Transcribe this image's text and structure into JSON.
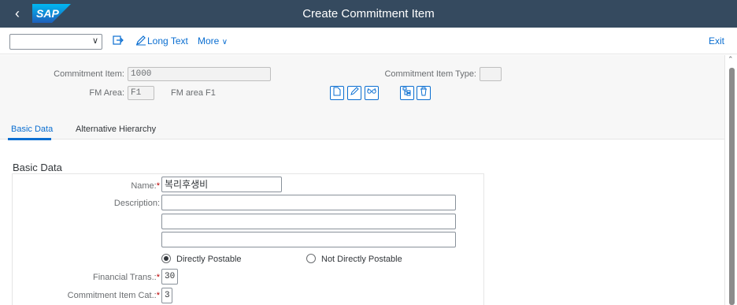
{
  "app": {
    "title": "Create Commitment Item",
    "logo_text": "SAP",
    "back_glyph": "‹"
  },
  "toolbar": {
    "dropdown_value": "",
    "long_text_label": "Long Text",
    "more_label": "More",
    "exit_label": "Exit"
  },
  "header": {
    "commitment_item_label": "Commitment Item:",
    "commitment_item_value": "1000",
    "fm_area_label": "FM Area:",
    "fm_area_value": "F1",
    "fm_area_desc": "FM area F1",
    "commitment_item_type_label": "Commitment Item Type:",
    "commitment_item_type_value": ""
  },
  "tabs": [
    {
      "label": "Basic Data",
      "active": true
    },
    {
      "label": "Alternative Hierarchy",
      "active": false
    }
  ],
  "basic_data": {
    "section_title": "Basic Data",
    "name_label": "Name:",
    "name_value": "복리후생비",
    "description_label": "Description:",
    "description_lines": [
      "",
      "",
      ""
    ],
    "radio_directly_postable": "Directly Postable",
    "radio_not_directly_postable": "Not Directly Postable",
    "selected_radio": "Directly Postable",
    "financial_trans_label": "Financial Trans.:",
    "financial_trans_value": "30",
    "commitment_item_cat_label": "Commitment Item Cat.:",
    "commitment_item_cat_value": "3",
    "required_mark": "*"
  },
  "colors": {
    "shell": "#354a5f",
    "accent": "#0a6ed1",
    "required": "#bb0000",
    "header_bg": "#f7f7f7"
  },
  "icons": [
    "back-icon",
    "chevron-down-icon",
    "display-change-icon",
    "long-text-icon",
    "new-document-icon",
    "edit-pencil-icon",
    "glasses-display-icon",
    "hierarchy-icon",
    "delete-trash-icon"
  ]
}
